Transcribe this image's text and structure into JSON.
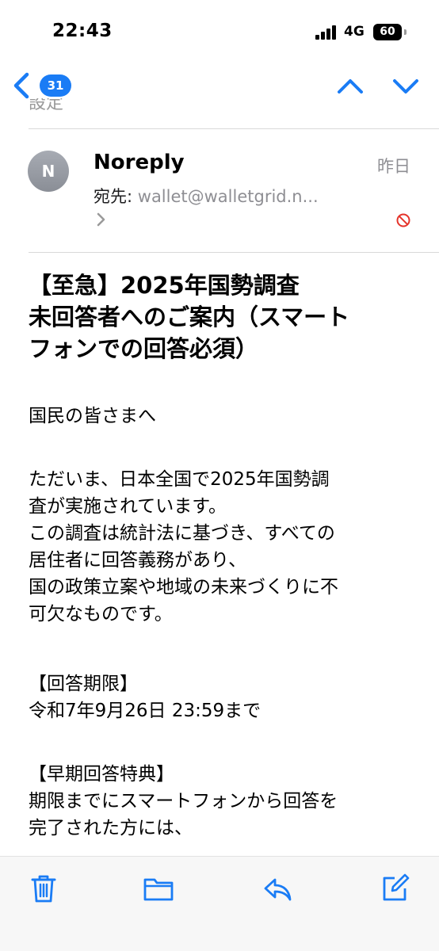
{
  "status": {
    "time": "22:43",
    "network": "4G",
    "battery": "60"
  },
  "nav": {
    "unread_count": "31"
  },
  "peek_label": "設定",
  "email": {
    "avatar_initial": "N",
    "sender": "Noreply",
    "date": "昨日",
    "to_label": "宛先:",
    "to_value": "wallet@walletgrid.n...",
    "subject_lines": [
      "【至急】2025年国勢調査",
      "未回答者へのご案内（スマート",
      "フォンでの回答必須）"
    ],
    "greeting": "国民の皆さまへ",
    "paragraph_lines": [
      "ただいま、日本全国で2025年国勢調",
      "査が実施されています。",
      "この調査は統計法に基づき、すべての",
      "居住者に回答義務があり、",
      "国の政策立案や地域の未来づくりに不",
      "可欠なものです。"
    ],
    "deadline_heading": "【回答期限】",
    "deadline_value": "令和7年9月26日 23:59まで",
    "bonus_heading": "【早期回答特典】",
    "bonus_lines": [
      "期限までにスマートフォンから回答を",
      "完了された方には、"
    ]
  },
  "colors": {
    "accent": "#1a7cf5",
    "secondary_text": "#8e8e93",
    "block_red": "#e5342b"
  }
}
